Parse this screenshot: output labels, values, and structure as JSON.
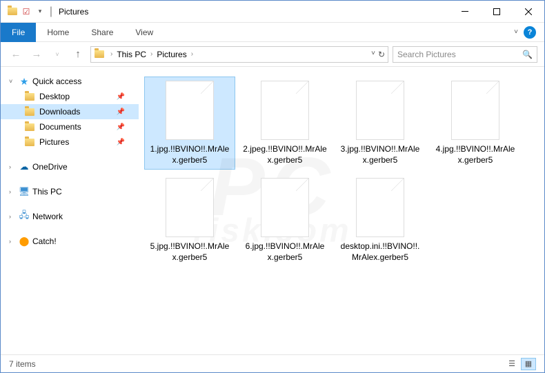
{
  "window": {
    "title": "Pictures"
  },
  "ribbon": {
    "file": "File",
    "tabs": [
      "Home",
      "Share",
      "View"
    ]
  },
  "breadcrumb": {
    "items": [
      "This PC",
      "Pictures"
    ],
    "search_placeholder": "Search Pictures"
  },
  "sidebar": {
    "quickaccess": {
      "label": "Quick access",
      "items": [
        {
          "label": "Desktop",
          "pinned": true
        },
        {
          "label": "Downloads",
          "pinned": true,
          "selected": true
        },
        {
          "label": "Documents",
          "pinned": true
        },
        {
          "label": "Pictures",
          "pinned": true
        }
      ]
    },
    "roots": [
      {
        "label": "OneDrive",
        "icon": "cloud"
      },
      {
        "label": "This PC",
        "icon": "pc"
      },
      {
        "label": "Network",
        "icon": "net"
      },
      {
        "label": "Catch!",
        "icon": "catch"
      }
    ]
  },
  "files": [
    {
      "name": "1.jpg.!!BVINO!!.MrAlex.gerber5",
      "selected": true
    },
    {
      "name": "2.jpeg.!!BVINO!!.MrAlex.gerber5"
    },
    {
      "name": "3.jpg.!!BVINO!!.MrAlex.gerber5"
    },
    {
      "name": "4.jpg.!!BVINO!!.MrAlex.gerber5"
    },
    {
      "name": "5.jpg.!!BVINO!!.MrAlex.gerber5"
    },
    {
      "name": "6.jpg.!!BVINO!!.MrAlex.gerber5"
    },
    {
      "name": "desktop.ini.!!BVINO!!.MrAlex.gerber5"
    }
  ],
  "status": {
    "count": "7 items"
  }
}
